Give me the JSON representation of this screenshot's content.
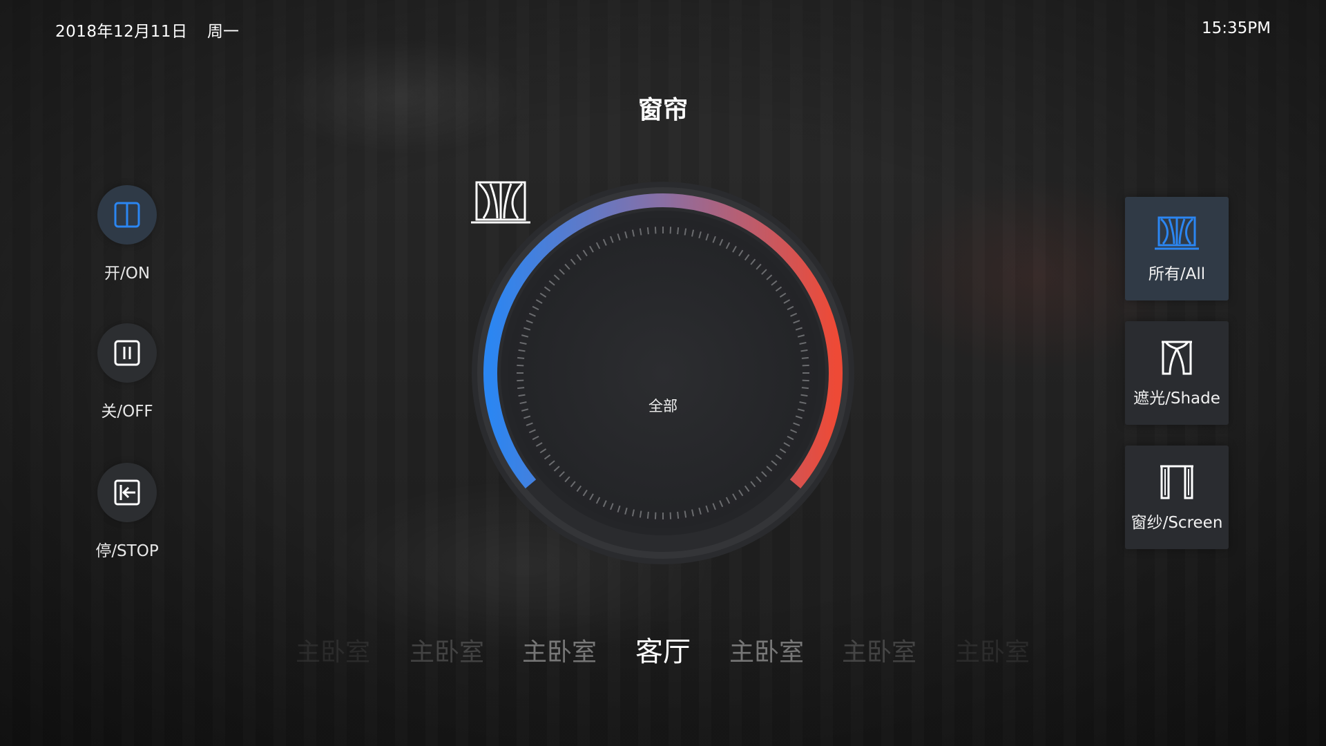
{
  "header": {
    "date": "2018年12月11日",
    "weekday": "周一",
    "time": "15:35PM"
  },
  "title": "窗帘",
  "controls": [
    {
      "label": "开/ON",
      "icon": "split-window-icon",
      "active": true
    },
    {
      "label": "关/OFF",
      "icon": "pause-icon",
      "active": false
    },
    {
      "label": "停/STOP",
      "icon": "stop-arrow-icon",
      "active": false
    }
  ],
  "dial": {
    "label": "全部",
    "icon": "curtain-icon",
    "gradient_start": "#2b86f2",
    "gradient_end": "#ee4a36"
  },
  "panels": [
    {
      "label": "所有/All",
      "icon": "curtain-all-icon",
      "active": true,
      "accent": "#2b86f2"
    },
    {
      "label": "遮光/Shade",
      "icon": "curtain-shade-icon",
      "active": false
    },
    {
      "label": "窗纱/Screen",
      "icon": "curtain-screen-icon",
      "active": false
    }
  ],
  "rooms": [
    {
      "label": "主卧室"
    },
    {
      "label": "主卧室"
    },
    {
      "label": "主卧室"
    },
    {
      "label": "客厅",
      "selected": true
    },
    {
      "label": "主卧室"
    },
    {
      "label": "主卧室"
    },
    {
      "label": "主卧室"
    }
  ]
}
